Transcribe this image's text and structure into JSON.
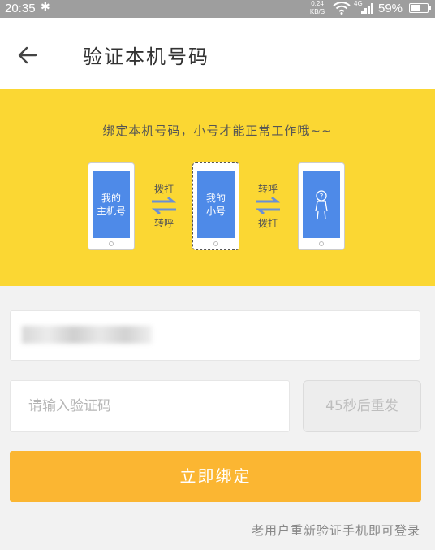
{
  "status_bar": {
    "time": "20:35",
    "bluetooth_icon": "bluetooth-icon",
    "speed_value": "0.24",
    "speed_unit": "KB/S",
    "network": "4G",
    "battery": "59%",
    "battery_level": 0.59
  },
  "header": {
    "title": "验证本机号码",
    "back_icon": "arrow-left-icon"
  },
  "banner": {
    "text": "绑定本机号码，小号才能正常工作哦~~",
    "phone1_line1": "我的",
    "phone1_line2": "主机号",
    "arrow1_top": "拨打",
    "arrow1_bottom": "转呼",
    "phone2_line1": "我的",
    "phone2_line2": "小号",
    "arrow2_top": "转呼",
    "arrow2_bottom": "拨打",
    "phone3_icon": "person-question-icon",
    "colors": {
      "background": "#fbd733",
      "screen": "#4e8ae8",
      "arrow": "#6a8fd6"
    }
  },
  "form": {
    "phone_value": "",
    "code_placeholder": "请输入验证码",
    "resend_label": "45秒后重发",
    "submit_label": "立即绑定",
    "footer_link": "老用户重新验证手机即可登录"
  },
  "colors": {
    "accent": "#fbb632",
    "banner": "#fbd733"
  }
}
